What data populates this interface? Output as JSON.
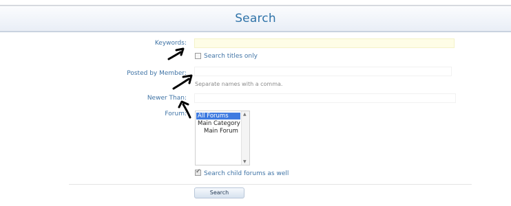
{
  "page": {
    "title": "Search"
  },
  "form": {
    "keywords_label": "Keywords:",
    "keywords_value": "",
    "search_titles_label": "Search titles only",
    "posted_by_label": "Posted by Member:",
    "posted_by_value": "",
    "posted_by_hint": "Separate names with a comma.",
    "newer_than_label": "Newer Than:",
    "newer_than_value": "",
    "forum_label": "Forum:",
    "forum_options": [
      "All Forums",
      "Main Category",
      "Main Forum"
    ],
    "forum_selected": "All Forums",
    "child_forums_label": "Search child forums as well",
    "child_forums_checked": true,
    "search_titles_checked": false,
    "submit_label": "Search"
  },
  "colors": {
    "label": "#3f73a5",
    "title": "#2f73a8",
    "keywords_bg": "#fefde6",
    "selected_bg": "#3f7be0"
  }
}
